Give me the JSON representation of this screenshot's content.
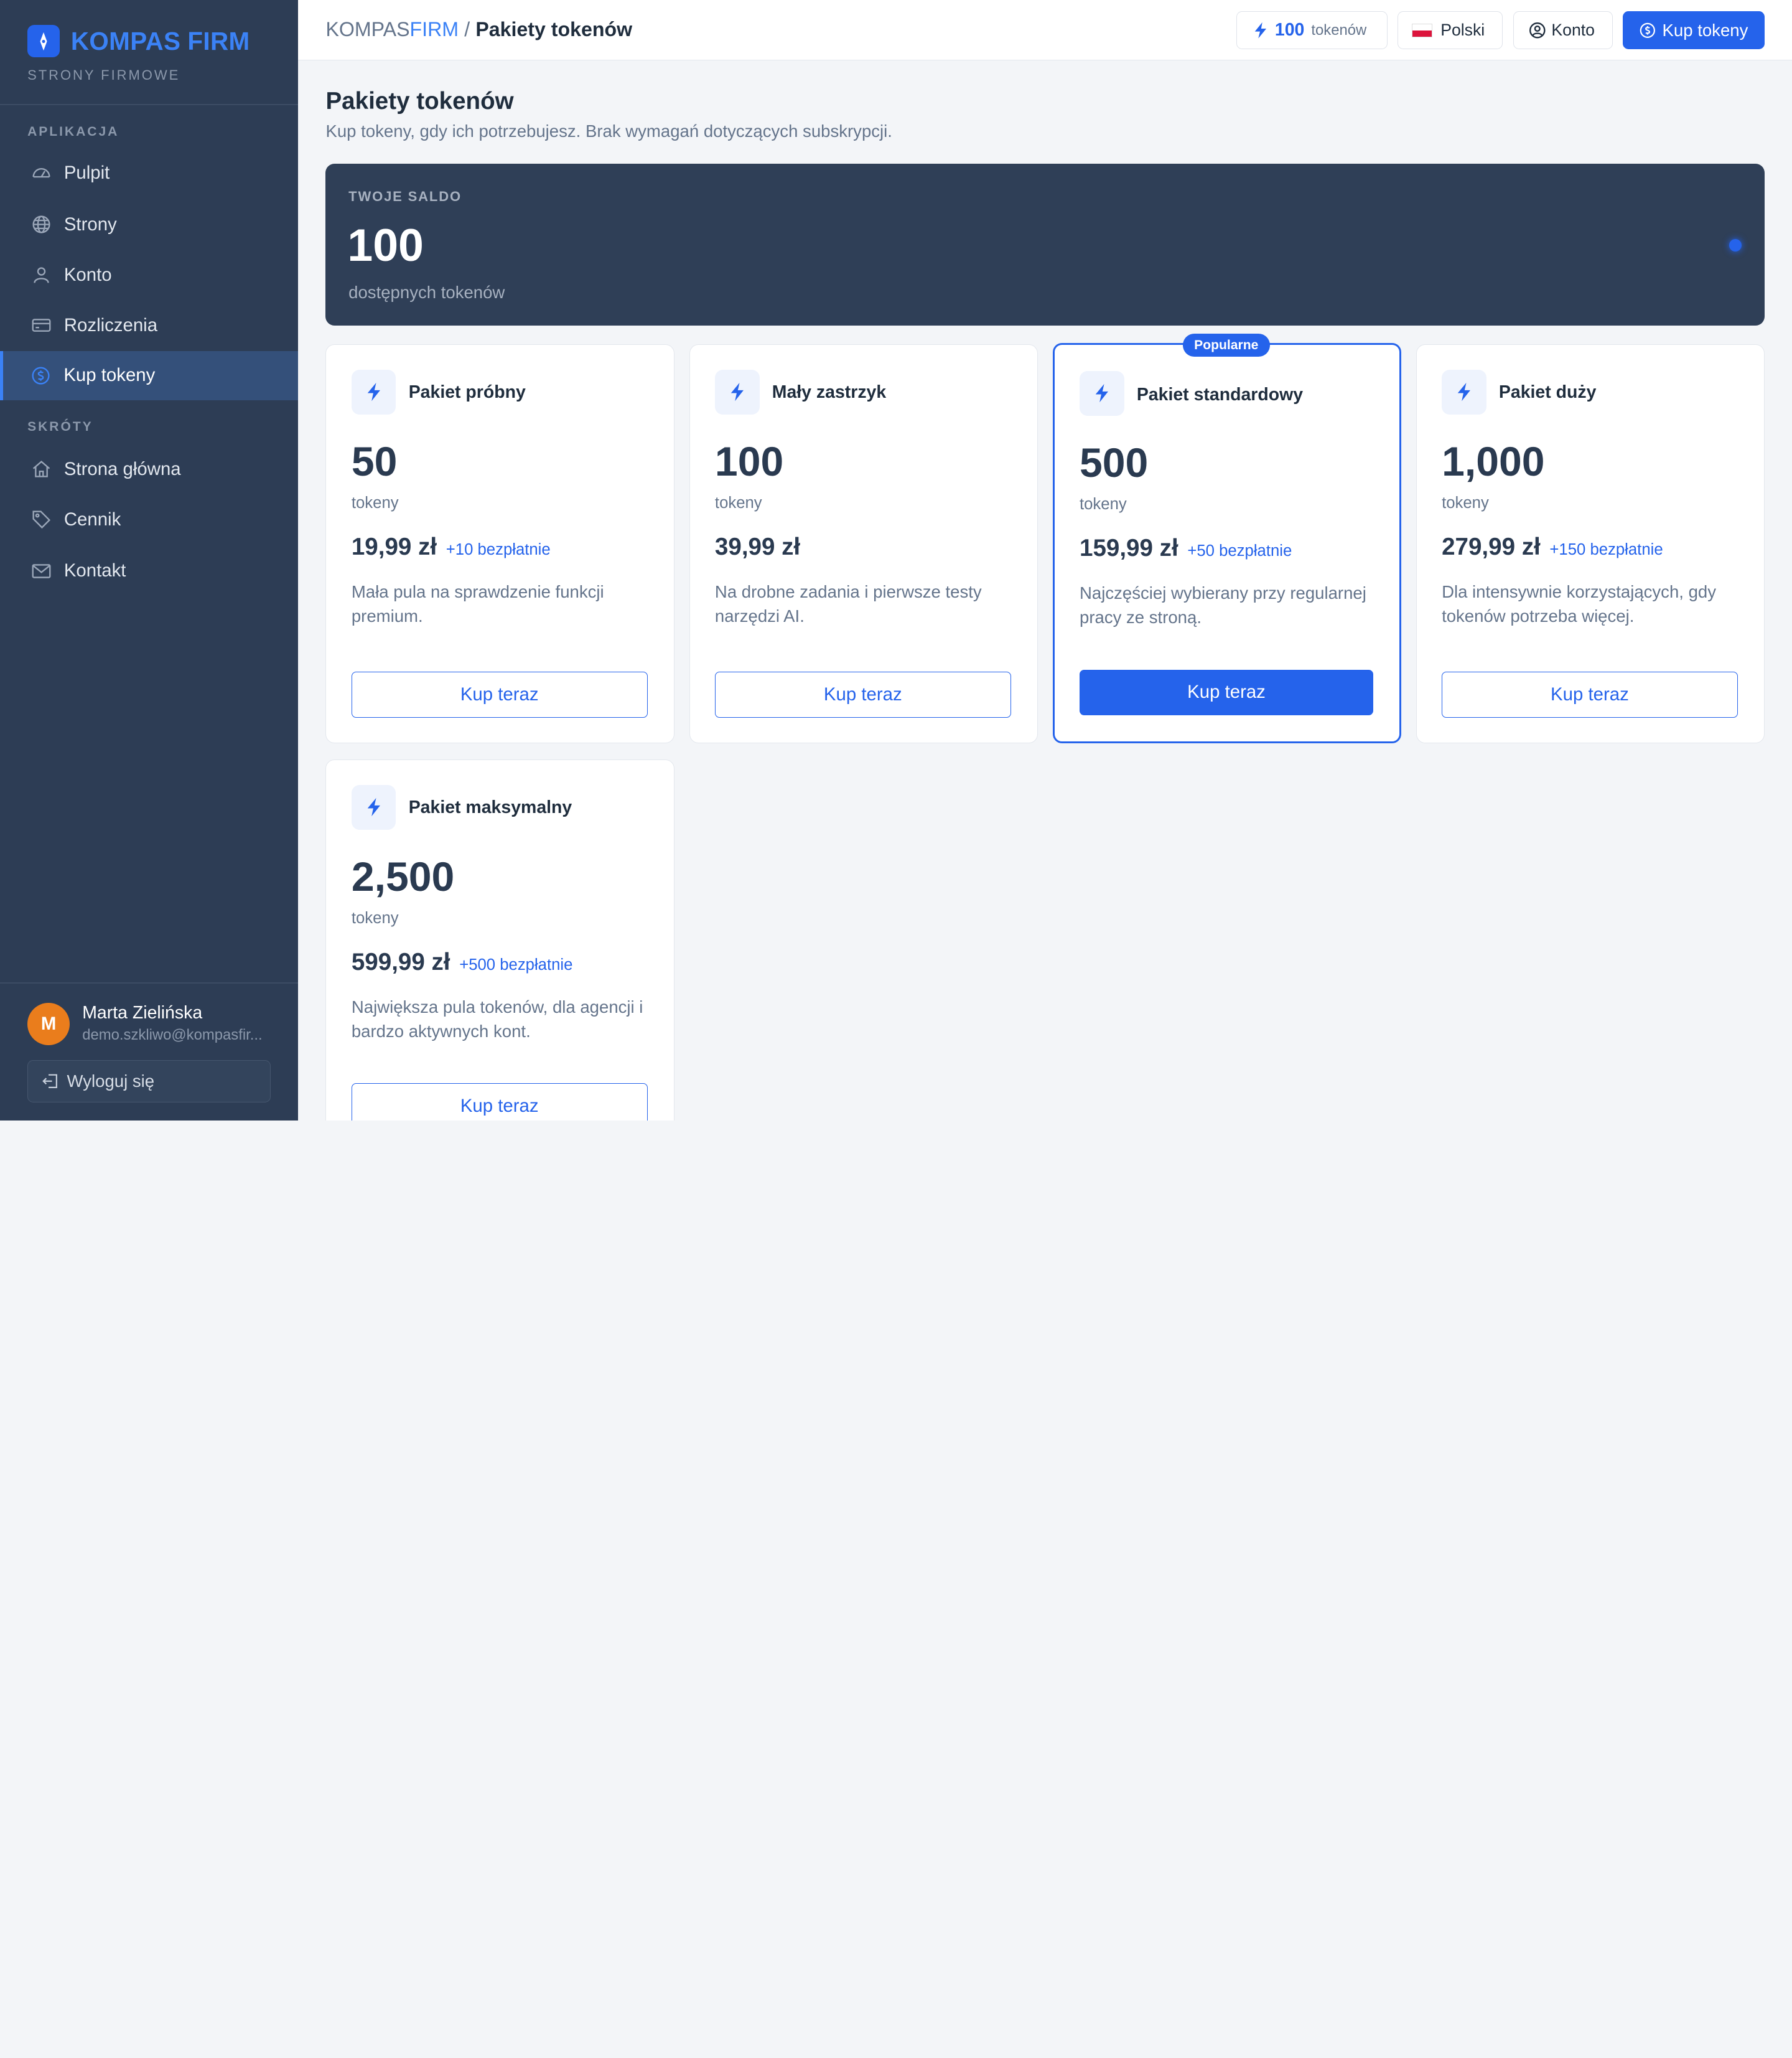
{
  "colors": {
    "accent": "#2563eb",
    "sidebar_bg": "#2d3d55",
    "balance_bg": "#2f3f57",
    "avatar": "#ea7d1c"
  },
  "brand": {
    "name_part1": "KOMPAS",
    "name_part2": "FIRM",
    "subtitle": "STRONY FIRMOWE",
    "logo_icon": "compass-icon"
  },
  "sidebar": {
    "section_app": "APLIKACJA",
    "app_items": [
      {
        "label": "Pulpit",
        "icon": "dashboard-icon"
      },
      {
        "label": "Strony",
        "icon": "globe-icon"
      },
      {
        "label": "Konto",
        "icon": "user-icon"
      },
      {
        "label": "Rozliczenia",
        "icon": "credit-card-icon"
      },
      {
        "label": "Kup tokeny",
        "icon": "coin-icon",
        "active": true
      }
    ],
    "section_shortcuts": "SKRÓTY",
    "shortcut_items": [
      {
        "label": "Strona główna",
        "icon": "home-icon"
      },
      {
        "label": "Cennik",
        "icon": "tag-icon"
      },
      {
        "label": "Kontakt",
        "icon": "mail-icon"
      }
    ],
    "user": {
      "initial": "M",
      "name": "Marta Zielińska",
      "email": "demo.szkliwo@kompasfir..."
    },
    "logout_label": "Wyloguj się"
  },
  "topbar": {
    "breadcrumb_root_1": "KOMPAS",
    "breadcrumb_root_2": "FIRM",
    "breadcrumb_sep": "/",
    "breadcrumb_current": "Pakiety tokenów",
    "token_count": "100",
    "token_label": "tokenów",
    "language": "Polski",
    "account": "Konto",
    "buy": "Kup tokeny"
  },
  "page": {
    "title": "Pakiety tokenów",
    "subtitle": "Kup tokeny, gdy ich potrzebujesz. Brak wymagań dotyczących subskrypcji."
  },
  "balance": {
    "label": "TWOJE SALDO",
    "value": "100",
    "caption": "dostępnych tokenów"
  },
  "popular_badge": "Popularne",
  "packages": [
    {
      "name": "Pakiet próbny",
      "amount": "50",
      "unit": "tokeny",
      "price": "19,99 zł",
      "bonus": "+10 bezpłatnie",
      "desc": "Mała pula na sprawdzenie funkcji premium.",
      "button": "Kup teraz"
    },
    {
      "name": "Mały zastrzyk",
      "amount": "100",
      "unit": "tokeny",
      "price": "39,99 zł",
      "bonus": "",
      "desc": "Na drobne zadania i pierwsze testy narzędzi AI.",
      "button": "Kup teraz"
    },
    {
      "name": "Pakiet standardowy",
      "amount": "500",
      "unit": "tokeny",
      "price": "159,99 zł",
      "bonus": "+50 bezpłatnie",
      "desc": "Najczęściej wybierany przy regularnej pracy ze stroną.",
      "button": "Kup teraz",
      "popular": true
    },
    {
      "name": "Pakiet duży",
      "amount": "1,000",
      "unit": "tokeny",
      "price": "279,99 zł",
      "bonus": "+150 bezpłatnie",
      "desc": "Dla intensywnie korzystających, gdy tokenów potrzeba więcej.",
      "button": "Kup teraz"
    },
    {
      "name": "Pakiet maksymalny",
      "amount": "2,500",
      "unit": "tokeny",
      "price": "599,99 zł",
      "bonus": "+500 bezpłatnie",
      "desc": "Największa pula tokenów, dla agencji i bardzo aktywnych kont.",
      "button": "Kup teraz"
    }
  ]
}
